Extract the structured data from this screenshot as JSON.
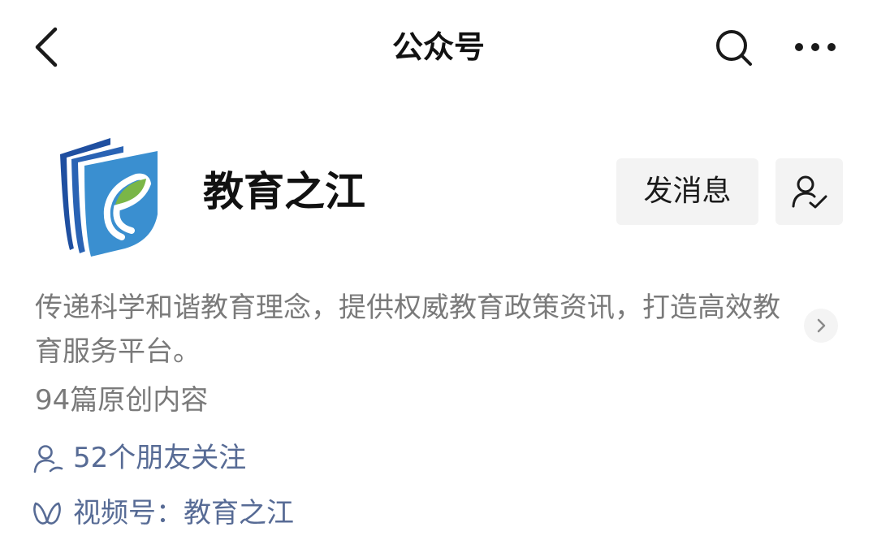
{
  "nav": {
    "title": "公众号",
    "back_icon": "back-chevron-icon",
    "search_icon": "search-icon",
    "more_icon": "more-dots-icon"
  },
  "profile": {
    "name": "教育之江",
    "logo_icon": "leaf-book-logo",
    "message_button": "发消息",
    "follow_icon": "user-check-icon"
  },
  "description": {
    "text": "传递科学和谐教育理念，提供权威教育政策资讯，打造高效教育服务平台。",
    "arrow_icon": "chevron-right-icon"
  },
  "stats": {
    "original_count": "94篇原创内容",
    "friends_following": "52个朋友关注",
    "friends_icon": "friends-icon",
    "channels": "视频号：教育之江",
    "channels_icon": "channels-butterfly-icon"
  },
  "colors": {
    "link": "#576b95",
    "muted": "#7a7a7a",
    "button_bg": "#f3f3f3",
    "logo_dark_blue": "#1f4fa0",
    "logo_light_blue": "#3a8fd0",
    "logo_green": "#7ab648"
  }
}
